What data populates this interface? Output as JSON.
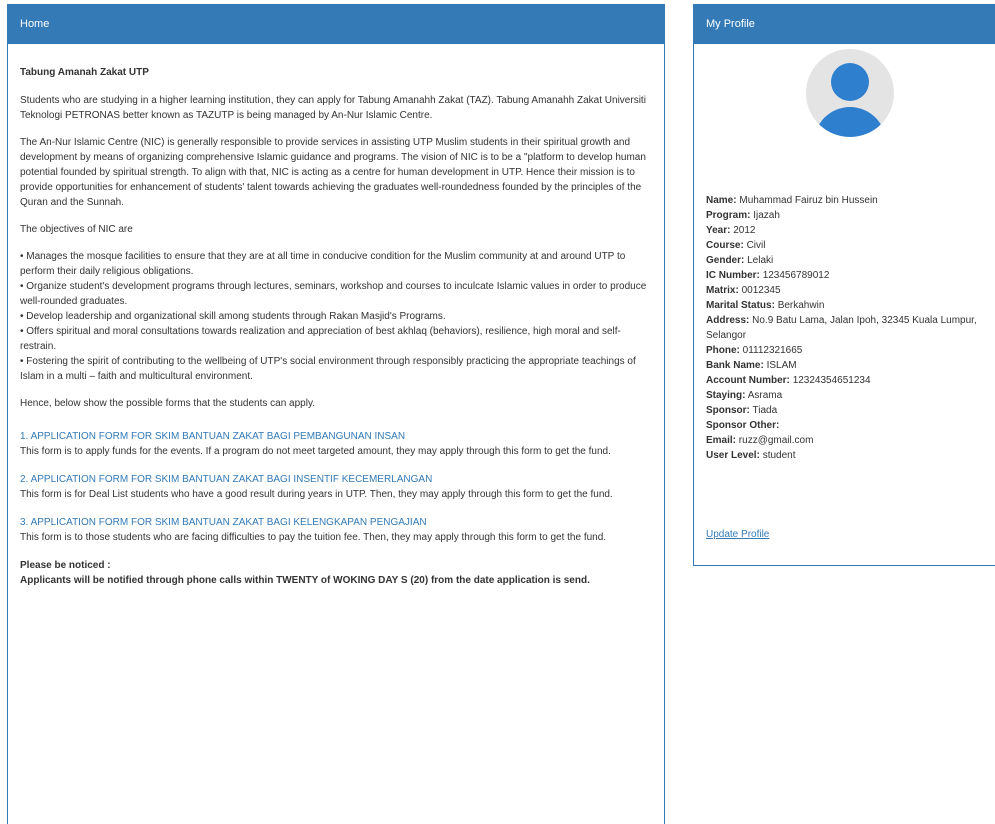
{
  "home": {
    "heading": "Home",
    "title": "Tabung Amanah Zakat UTP",
    "intro": "Students who are studying in a higher learning institution, they can apply for Tabung Amanahh Zakat (TAZ). Tabung Amanahh Zakat Universiti Teknologi PETRONAS better known as TAZUTP is being managed by An-Nur Islamic Centre.",
    "about": "The An-Nur Islamic Centre (NIC) is generally responsible to provide services in assisting UTP Muslim students in their spiritual growth and development by means of organizing comprehensive Islamic guidance and programs. The vision of NIC is to be a \"platform to develop human potential founded by spiritual strength. To align with that, NIC is acting as a centre for human development in UTP. Hence their mission is to provide opportunities for enhancement of students' talent towards achieving the graduates well-roundedness founded by the principles of the Quran and the Sunnah.",
    "objectives_heading": "The objectives of NIC are",
    "objectives": [
      "• Manages the mosque facilities to ensure that they are at all time in conducive condition for the Muslim community at and around UTP to perform their daily religious obligations.",
      "• Organize student's development programs through lectures, seminars, workshop and courses to inculcate Islamic values in order to produce well-rounded graduates.",
      "• Develop leadership and organizational skill among students through Rakan Masjid's Programs.",
      "• Offers spiritual and moral consultations towards realization and appreciation of best akhlaq (behaviors), resilience, high moral and self-restrain.",
      "• Fostering the spirit of contributing to the wellbeing of UTP's social environment through responsibly practicing the appropriate teachings of Islam in a multi – faith and multicultural environment."
    ],
    "forms_intro": "Hence, below show the possible forms that the students can apply.",
    "forms": [
      {
        "number": "1. ",
        "link": "APPLICATION FORM FOR SKIM BANTUAN ZAKAT BAGI PEMBANGUNAN INSAN",
        "desc": "This form is to apply funds for the events. If a program do not meet targeted amount, they may apply through this form to get the fund."
      },
      {
        "number": "2. ",
        "link": "APPLICATION FORM FOR SKIM BANTUAN ZAKAT BAGI INSENTIF KECEMERLANGAN",
        "desc": "This form is for Deal List students who have a good result during years in UTP. Then, they may apply through this form to get the fund."
      },
      {
        "number": "3. ",
        "link": "APPLICATION FORM FOR SKIM BANTUAN ZAKAT BAGI KELENGKAPAN PENGAJIAN",
        "desc": "This form is to those students who are facing difficulties to pay the tuition fee. Then, they may apply through this form to get the fund."
      }
    ],
    "notice_title": "Please be noticed :",
    "notice_text": "Applicants will be notified through phone calls within TWENTY of WOKING DAY S (20) from the date application is send."
  },
  "profile": {
    "heading": "My Profile",
    "avatar_icon": "user-avatar-icon",
    "fields": [
      {
        "label": "Name:",
        "value": "Muhammad Fairuz bin Hussein"
      },
      {
        "label": "Program:",
        "value": "Ijazah"
      },
      {
        "label": "Year:",
        "value": "2012"
      },
      {
        "label": "Course:",
        "value": "Civil"
      },
      {
        "label": "Gender:",
        "value": "Lelaki"
      },
      {
        "label": "IC Number:",
        "value": "123456789012"
      },
      {
        "label": "Matrix:",
        "value": "0012345"
      },
      {
        "label": "Marital Status:",
        "value": "Berkahwin"
      },
      {
        "label": "Address:",
        "value": "No.9 Batu Lama, Jalan Ipoh, 32345 Kuala Lumpur, Selangor"
      },
      {
        "label": "Phone:",
        "value": "01112321665"
      },
      {
        "label": "Bank Name:",
        "value": "ISLAM"
      },
      {
        "label": "Account Number:",
        "value": "12324354651234"
      },
      {
        "label": "Staying:",
        "value": "Asrama"
      },
      {
        "label": "Sponsor:",
        "value": "Tiada"
      },
      {
        "label": "Sponsor Other:",
        "value": ""
      },
      {
        "label": "Email:",
        "value": "ruzz@gmail.com"
      },
      {
        "label": "User Level:",
        "value": "student"
      }
    ],
    "update_label": "Update Profile"
  },
  "colors": {
    "primary": "#337ab7",
    "avatar_fg": "#2f7fcf",
    "avatar_bg": "#e4e4e4"
  }
}
